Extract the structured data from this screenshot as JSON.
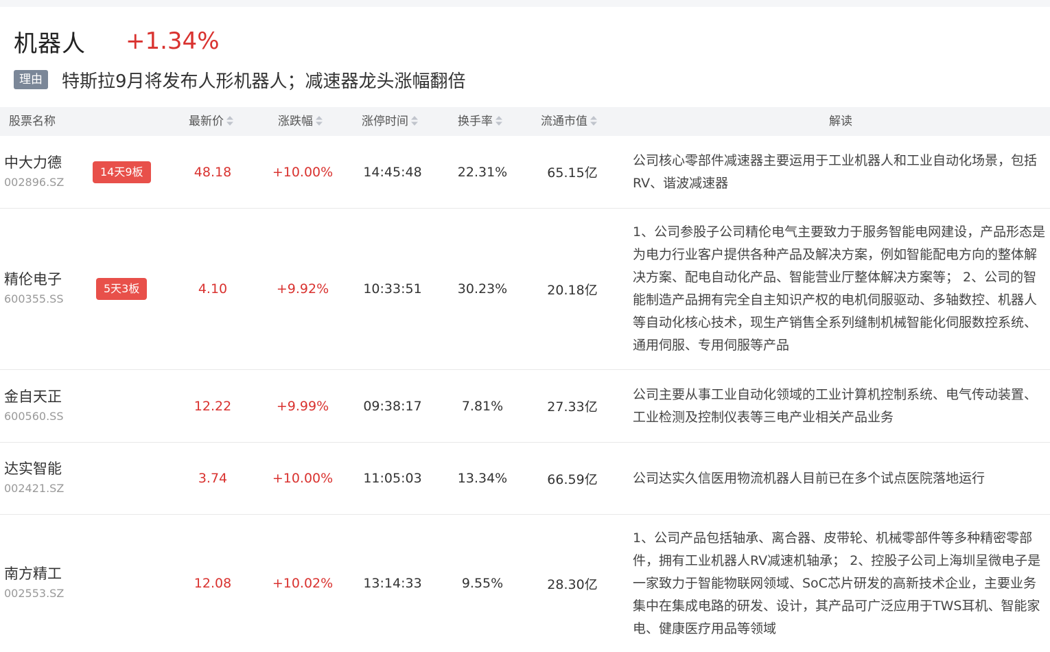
{
  "header": {
    "sector_name": "机器人",
    "sector_change": "+1.34%",
    "reason_tag": "理由",
    "reason_text": "特斯拉9月将发布人形机器人；减速器龙头涨幅翻倍"
  },
  "table": {
    "columns": {
      "name": "股票名称",
      "price": "最新价",
      "change": "涨跌幅",
      "limit_time": "涨停时间",
      "turnover": "换手率",
      "market_cap": "流通市值",
      "interpretation": "解读"
    },
    "rows": [
      {
        "name": "中大力德",
        "code": "002896.SZ",
        "badge": "14天9板",
        "price": "48.18",
        "change": "+10.00%",
        "limit_time": "14:45:48",
        "turnover": "22.31%",
        "market_cap": "65.15亿",
        "interpretation": "公司核心零部件减速器主要运用于工业机器人和工业自动化场景，包括RV、谐波减速器"
      },
      {
        "name": "精伦电子",
        "code": "600355.SS",
        "badge": "5天3板",
        "price": "4.10",
        "change": "+9.92%",
        "limit_time": "10:33:51",
        "turnover": "30.23%",
        "market_cap": "20.18亿",
        "interpretation": "1、公司参股子公司精伦电气主要致力于服务智能电网建设，产品形态是为电力行业客户提供各种产品及解决方案，例如智能配电方向的整体解决方案、配电自动化产品、智能营业厅整体解决方案等； 2、公司的智能制造产品拥有完全自主知识产权的电机伺服驱动、多轴数控、机器人等自动化核心技术，现生产销售全系列缝制机械智能化伺服数控系统、通用伺服、专用伺服等产品"
      },
      {
        "name": "金自天正",
        "code": "600560.SS",
        "badge": "",
        "price": "12.22",
        "change": "+9.99%",
        "limit_time": "09:38:17",
        "turnover": "7.81%",
        "market_cap": "27.33亿",
        "interpretation": "公司主要从事工业自动化领域的工业计算机控制系统、电气传动装置、工业检测及控制仪表等三电产业相关产品业务"
      },
      {
        "name": "达实智能",
        "code": "002421.SZ",
        "badge": "",
        "price": "3.74",
        "change": "+10.00%",
        "limit_time": "11:05:03",
        "turnover": "13.34%",
        "market_cap": "66.59亿",
        "interpretation": "公司达实久信医用物流机器人目前已在多个试点医院落地运行"
      },
      {
        "name": "南方精工",
        "code": "002553.SZ",
        "badge": "",
        "price": "12.08",
        "change": "+10.02%",
        "limit_time": "13:14:33",
        "turnover": "9.55%",
        "market_cap": "28.30亿",
        "interpretation": "1、公司产品包括轴承、离合器、皮带轮、机械零部件等多种精密零部件，拥有工业机器人RV减速机轴承； 2、控股子公司上海圳呈微电子是一家致力于智能物联网领域、SoC芯片研发的高新技术企业，主要业务集中在集成电路的研发、设计，其产品可广泛应用于TWS耳机、智能家电、健康医疗用品等领域"
      }
    ]
  },
  "colors": {
    "up": "#d9322f",
    "badge": "#e8504a",
    "reason_tag_bg": "#7b8798",
    "header_bg": "#f3f4f6"
  }
}
